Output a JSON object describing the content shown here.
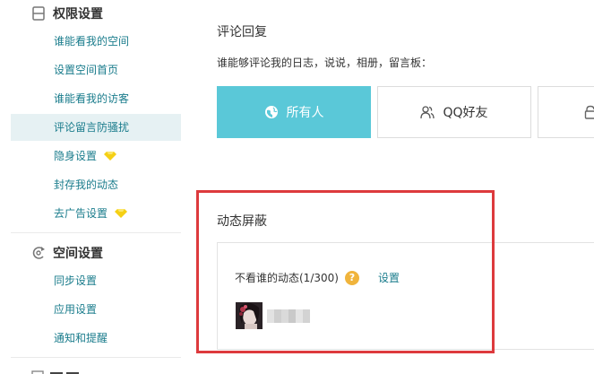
{
  "sidebar": {
    "sections": [
      {
        "title": "权限设置",
        "icon": "lock-icon",
        "items": [
          {
            "label": "谁能看我的空间"
          },
          {
            "label": "设置空间首页"
          },
          {
            "label": "谁能看我的访客"
          },
          {
            "label": "评论留言防骚扰",
            "active": true
          },
          {
            "label": "隐身设置",
            "badge": "diamond-icon"
          },
          {
            "label": "封存我的动态"
          },
          {
            "label": "去广告设置",
            "badge": "diamond-icon"
          }
        ]
      },
      {
        "title": "空间设置",
        "icon": "settings-refresh-icon",
        "items": [
          {
            "label": "同步设置"
          },
          {
            "label": "应用设置"
          },
          {
            "label": "通知和提醒"
          }
        ]
      }
    ]
  },
  "main": {
    "comment_reply": {
      "title": "评论回复",
      "subtitle": "谁能够评论我的日志，说说，相册，留言板：",
      "options": [
        {
          "label": "所有人",
          "icon": "globe-icon",
          "selected": true
        },
        {
          "label": "QQ好友",
          "icon": "friends-icon",
          "selected": false
        },
        {
          "label": "",
          "icon": "lock-icon",
          "selected": false
        }
      ]
    },
    "feed_block": {
      "title": "动态屏蔽",
      "blocked_label": "不看谁的动态(1/300)",
      "help_symbol": "?",
      "settings_link": "设置"
    }
  },
  "colors": {
    "accent": "#5ac8d8",
    "link": "#1a7c8c",
    "active_bg": "#e6f1f3",
    "highlight_box": "#dd3a3d",
    "help_badge": "#f0b43c",
    "diamond": "#f5d015"
  }
}
